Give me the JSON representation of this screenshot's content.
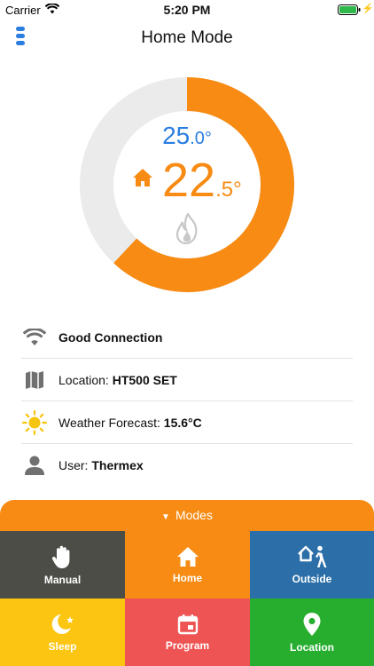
{
  "status_bar": {
    "carrier": "Carrier",
    "time": "5:20 PM"
  },
  "nav": {
    "title": "Home Mode"
  },
  "thermostat": {
    "target_whole": "25",
    "target_decimal": ".0°",
    "current_whole": "22",
    "current_decimal": ".5°",
    "setpoint_fraction": 0.62,
    "colors": {
      "ring_active": "#f78b14",
      "ring_track": "#ebebeb",
      "target_text": "#2a7de1",
      "current_text": "#f78b14"
    }
  },
  "info": {
    "connection": "Good Connection",
    "location_label": "Location: ",
    "location_value": "HT500 SET",
    "weather_label": "Weather Forecast: ",
    "weather_value": "15.6°C",
    "user_label": "User: ",
    "user_value": "Thermex"
  },
  "modes": {
    "header": "Modes",
    "tiles": [
      {
        "label": "Manual",
        "color": "#4d4d47",
        "icon": "hand-icon"
      },
      {
        "label": "Home",
        "color": "#f78b14",
        "icon": "home-icon"
      },
      {
        "label": "Outside",
        "color": "#2c6fa8",
        "icon": "walking-person-icon"
      },
      {
        "label": "Sleep",
        "color": "#fbc512",
        "icon": "moon-icon"
      },
      {
        "label": "Program",
        "color": "#ef5454",
        "icon": "calendar-icon"
      },
      {
        "label": "Location",
        "color": "#27ae2f",
        "icon": "location-pin-icon"
      }
    ]
  }
}
